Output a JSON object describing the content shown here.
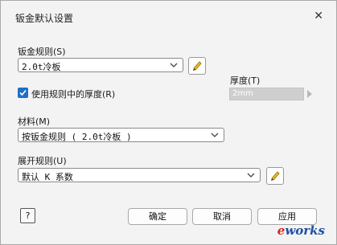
{
  "window": {
    "title": "钣金默认设置",
    "close_glyph": "✕"
  },
  "sheet_rule": {
    "label": "钣金规则(S)",
    "value": "2.0t冷板"
  },
  "use_thickness": {
    "label": "使用规则中的厚度(R)",
    "checked": true
  },
  "thickness": {
    "label": "厚度(T)",
    "value": "2mm"
  },
  "material": {
    "label": "材料(M)",
    "value": "按钣金规则 ( 2.0t冷板 )"
  },
  "unfold_rule": {
    "label": "展开规则(U)",
    "value": "默认 K 系数"
  },
  "buttons": {
    "help": "?",
    "ok": "确定",
    "cancel": "取消",
    "apply": "应用"
  },
  "watermark": {
    "text_e": "e",
    "text_works": "works"
  },
  "colors": {
    "accent": "#1f6fc5",
    "pencil": "#f2c012",
    "watermark_red": "#d7261e",
    "watermark_blue": "#1e4fa3"
  },
  "icons": [
    "close-icon",
    "chevron-down-icon",
    "pencil-icon",
    "checkmark-icon",
    "help-icon"
  ]
}
